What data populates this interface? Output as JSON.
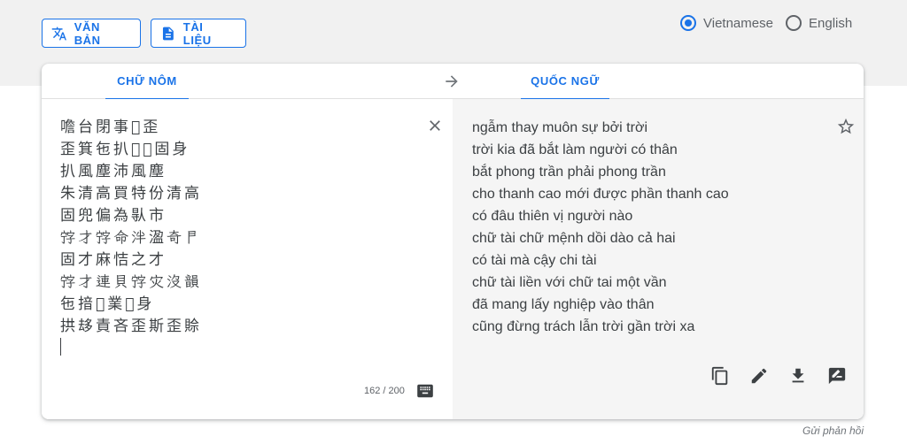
{
  "modes": {
    "text_label": "VĂN BẢN",
    "doc_label": "TÀI LIỆU"
  },
  "languages": [
    {
      "label": "Vietnamese",
      "selected": true
    },
    {
      "label": "English",
      "selected": false
    }
  ],
  "tabs": {
    "source": "CHỮ NÔM",
    "target": "QUỐC NGỮ"
  },
  "source": {
    "lines": [
      "噡台閉事𡗶歪",
      "歪箕㐌扒𠃣𠊛固身",
      "扒風塵沛風塵",
      "朱清高買特份清高",
      "固兜偏為𠊛市",
      "𡨸才𡨸命泮溋奇𠁣",
      "固才麻恄之才",
      "𡨸才連貝𡨸灾沒韻",
      "㐌揞𦋦業𠓨身",
      "拱𠫾責吝歪斯歪賒"
    ],
    "counter": "162 / 200"
  },
  "target": {
    "lines": [
      "ngẫm thay muôn sự bởi trời",
      "trời kia đã bắt làm người có thân",
      "bắt phong trần phải phong trần",
      "cho thanh cao mới được phần thanh cao",
      "có đâu thiên vị người nào",
      "chữ tài chữ mệnh dồi dào cả hai",
      "có tài mà cậy chi tài",
      "chữ tài liền với chữ tai một vần",
      "đã mang lấy nghiệp vào thân",
      "cũng đừng trách lẫn trời gần trời xa"
    ]
  },
  "icons": {
    "text_mode": "translate-icon",
    "doc_mode": "document-icon",
    "swap": "arrow-right-icon",
    "clear": "close-icon",
    "keyboard": "keyboard-icon",
    "star": "star-icon",
    "copy": "copy-icon",
    "edit": "edit-icon",
    "download": "download-icon",
    "feedback": "rate-review-icon"
  },
  "footer": {
    "feedback_link": "Gửi phản hồi"
  },
  "colors": {
    "accent": "#1a73e8",
    "band": "#f1f1f1",
    "target_bg": "#f5f5f5"
  }
}
